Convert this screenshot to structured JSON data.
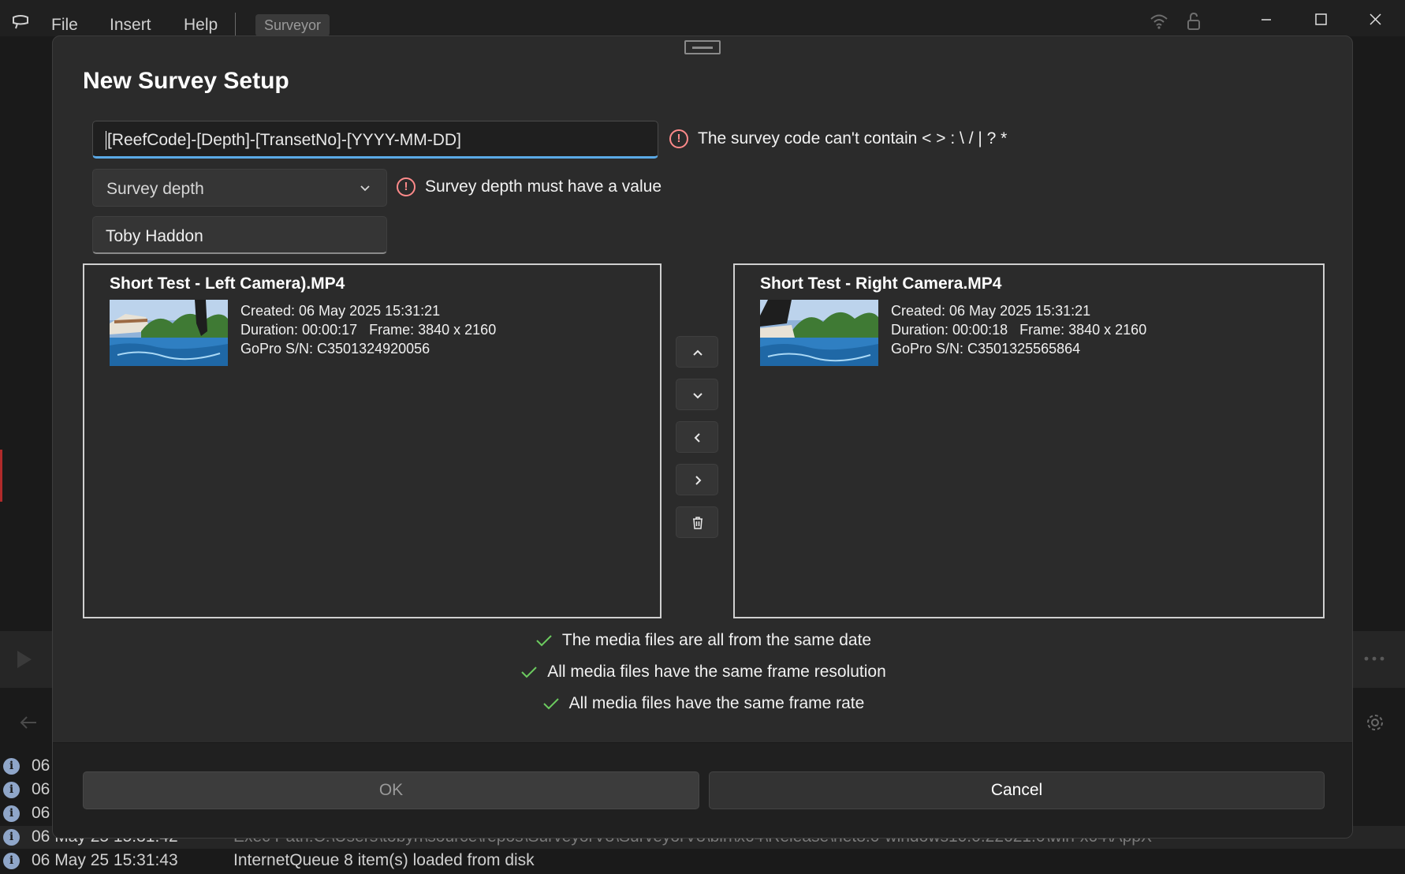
{
  "titlebar": {
    "menu": [
      "File",
      "Insert",
      "Help"
    ],
    "active_tab": "Surveyor"
  },
  "dialog": {
    "title": "New Survey Setup",
    "survey_code": {
      "value": "[ReefCode]-[Depth]-[TransetNo]-[YYYY-MM-DD]",
      "error": "The survey code can't contain < > : \\ / | ? *"
    },
    "survey_depth": {
      "placeholder": "Survey depth",
      "error": "Survey depth must have a value"
    },
    "surveyor_name": "Toby Haddon",
    "left_media": {
      "title": "Short Test - Left Camera).MP4",
      "created": "Created: 06 May 2025 15:31:21",
      "duration_frame": "Duration: 00:00:17   Frame: 3840 x 2160",
      "serial": "GoPro S/N: C3501324920056"
    },
    "right_media": {
      "title": "Short Test - Right Camera.MP4",
      "created": "Created: 06 May 2025 15:31:21",
      "duration_frame": "Duration: 00:00:18   Frame: 3840 x 2160",
      "serial": "GoPro S/N: C3501325565864"
    },
    "side_buttons": [
      "chevron-up-icon",
      "chevron-down-icon",
      "chevron-left-icon",
      "chevron-right-icon",
      "trash-icon"
    ],
    "checks": [
      "The media files are all from the same date",
      "All media files have the same frame resolution",
      "All media files have the same frame rate"
    ],
    "ok_label": "OK",
    "cancel_label": "Cancel"
  },
  "background_log": {
    "rows": [
      {
        "date": "06",
        "message": ""
      },
      {
        "date": "06",
        "message": ""
      },
      {
        "date": "06",
        "message": ""
      },
      {
        "date": "06 May 25 15:31:42",
        "message": "Exec Path:C:\\Users\\tobyh\\source\\repos\\SurveyorV3\\SurveyorV3\\bin\\x64\\Release\\net8.0-windows10.0.22621.0\\win-x64\\AppX"
      },
      {
        "date": "06 May 25 15:31:43",
        "message": "InternetQueue 8 item(s) loaded from disk"
      }
    ]
  },
  "colors": {
    "accent": "#5aa9e6",
    "error": "#ff8a8a",
    "success": "#6ccb5f",
    "dialog_bg": "#2b2b2b"
  }
}
